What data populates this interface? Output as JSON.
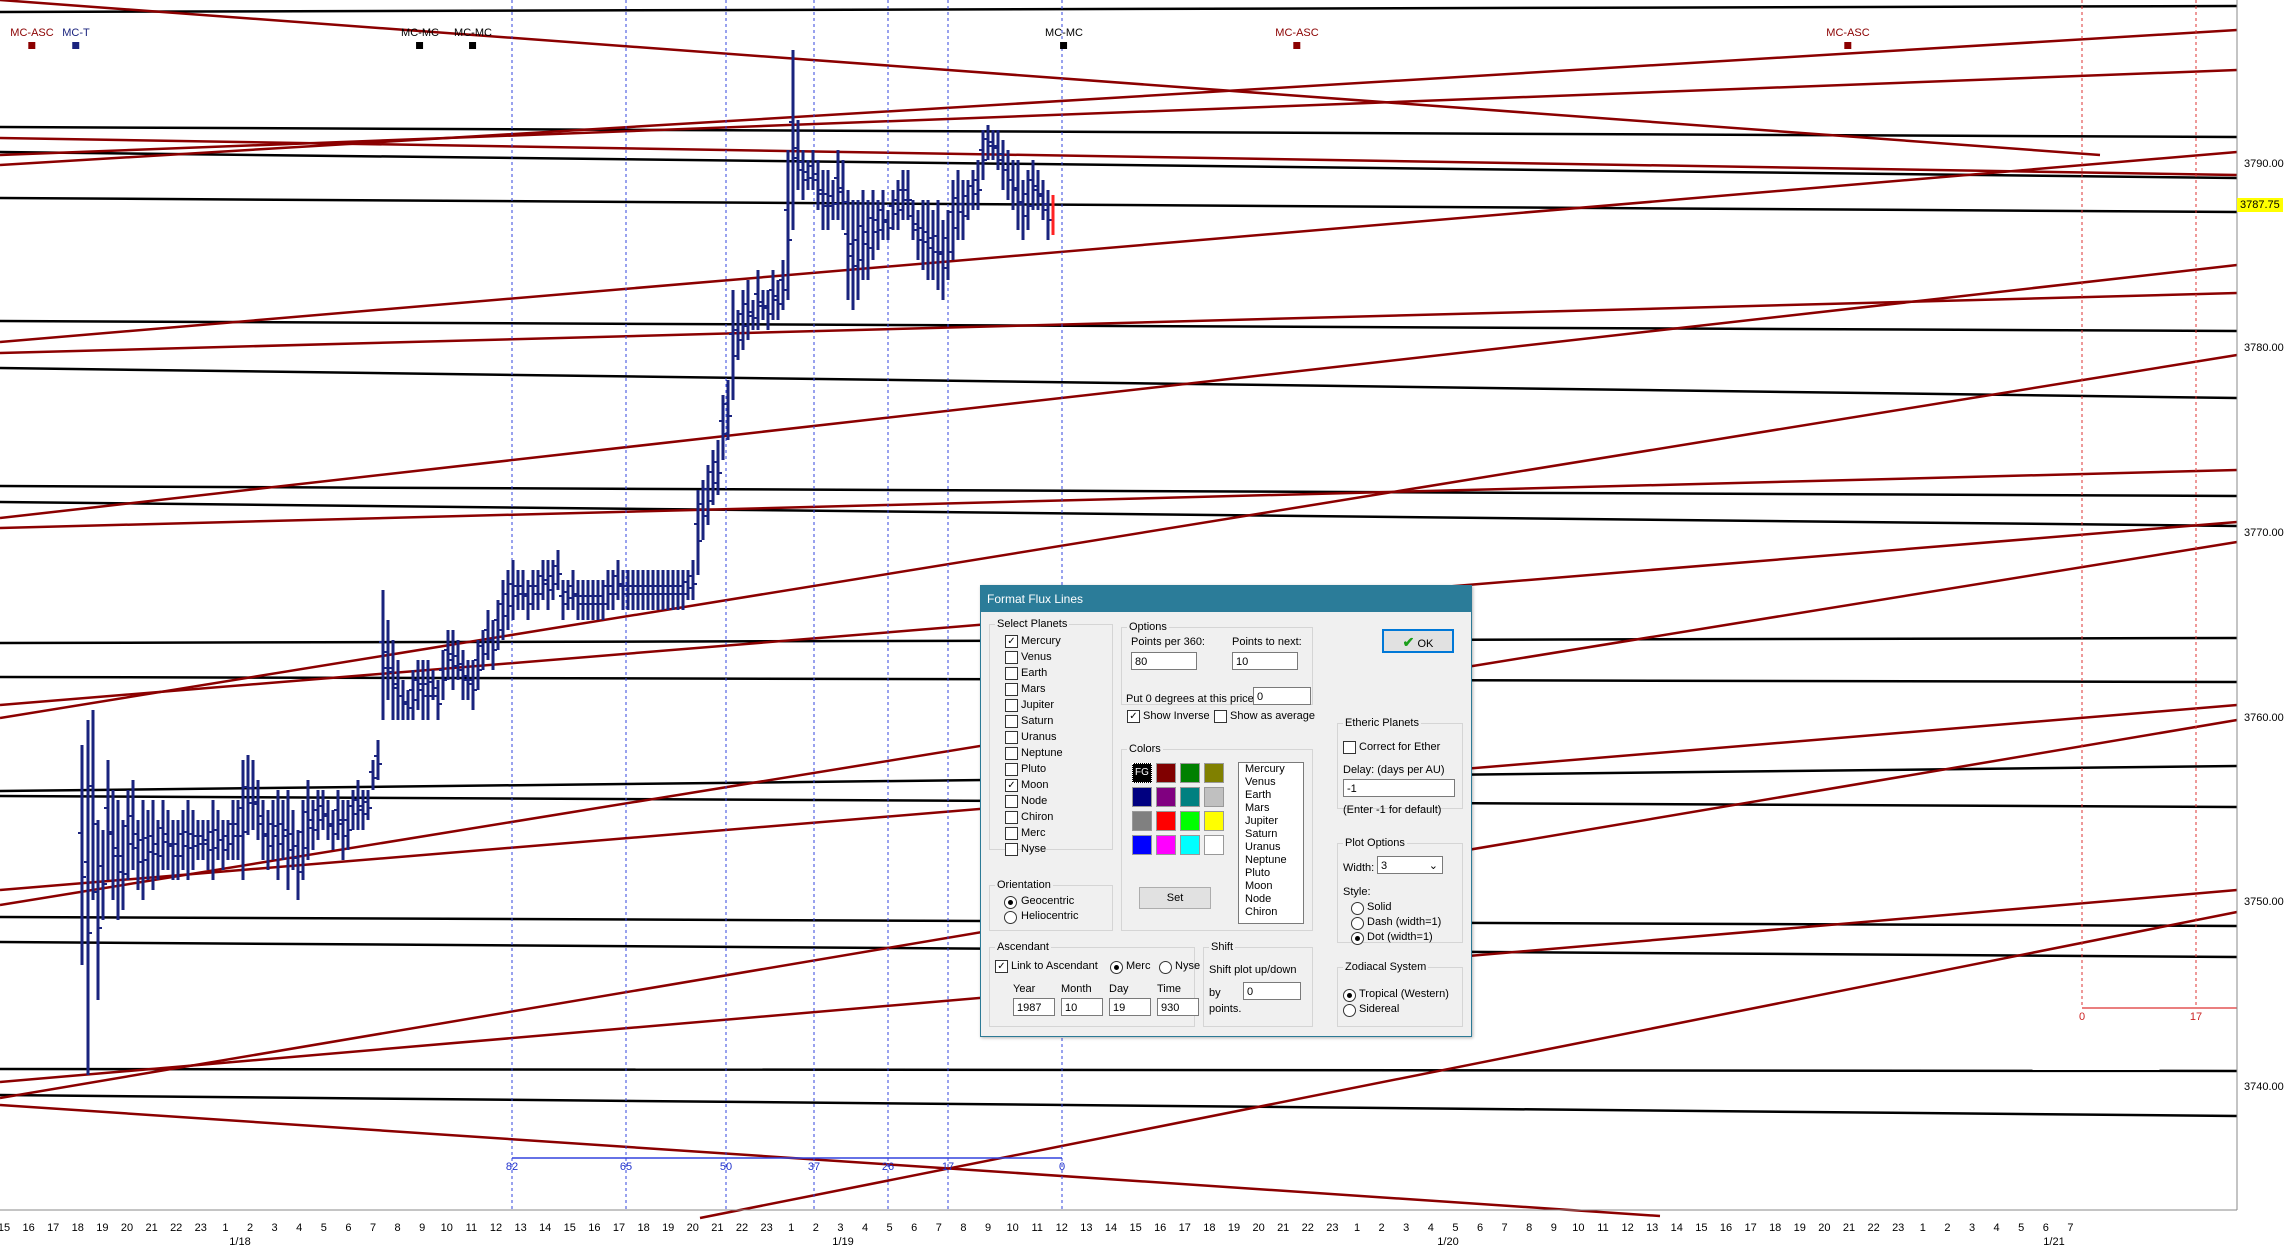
{
  "colors": {
    "bars": "#1a237e",
    "black_lines": "#000000",
    "red_lines": "#8b0000",
    "blue_dotted": "#3344dd",
    "red_dotted": "#dd3333",
    "last_bar": "#ff2222",
    "price_tag": "#ffff00"
  },
  "top_markers": [
    {
      "label": "MC-ASC",
      "color": "#8b0000"
    },
    {
      "label": "MC-T",
      "color": "#1a237e"
    },
    {
      "label": "MC-MC",
      "color": "#000000"
    },
    {
      "label": "MC-MC",
      "color": "#000000"
    },
    {
      "label": "MC-MC",
      "color": "#000000"
    },
    {
      "label": "MC-ASC",
      "color": "#8b0000"
    },
    {
      "label": "MC-ASC",
      "color": "#8b0000"
    }
  ],
  "y_axis": {
    "labels": [
      "3790.00",
      "3780.00",
      "3770.00",
      "3760.00",
      "3750.00",
      "3740.00"
    ],
    "current_price": "3787.75"
  },
  "x_axis": {
    "ticks": [
      "15",
      "16",
      "17",
      "18",
      "19",
      "20",
      "21",
      "22",
      "23",
      "1",
      "2",
      "3",
      "4",
      "5",
      "6",
      "7",
      "8",
      "9",
      "10",
      "11",
      "12",
      "13",
      "14",
      "15",
      "16",
      "17",
      "18",
      "19",
      "20",
      "21",
      "22",
      "23",
      "1",
      "2",
      "3",
      "4",
      "5",
      "6",
      "7",
      "8",
      "9",
      "10",
      "11",
      "12",
      "13",
      "14",
      "15",
      "16",
      "17",
      "18",
      "19",
      "20",
      "21",
      "22",
      "23",
      "1",
      "2",
      "3",
      "4",
      "5",
      "6",
      "7",
      "8",
      "9",
      "10",
      "11",
      "12",
      "13",
      "14",
      "15",
      "16",
      "17",
      "18",
      "19",
      "20",
      "21",
      "22",
      "23",
      "1",
      "2",
      "3",
      "4",
      "5",
      "6",
      "7"
    ],
    "dates": [
      "1/18",
      "1/19",
      "1/20",
      "1/21"
    ]
  },
  "cycle_labels": [
    "82",
    "65",
    "50",
    "37",
    "26",
    "17",
    "0"
  ],
  "right_cycle_labels": [
    "0",
    "17"
  ],
  "dialog": {
    "title": "Format Flux Lines",
    "select_planets": {
      "title": "Select Planets",
      "items": [
        {
          "name": "Mercury",
          "checked": true
        },
        {
          "name": "Venus",
          "checked": false
        },
        {
          "name": "Earth",
          "checked": false
        },
        {
          "name": "Mars",
          "checked": false
        },
        {
          "name": "Jupiter",
          "checked": false
        },
        {
          "name": "Saturn",
          "checked": false
        },
        {
          "name": "Uranus",
          "checked": false
        },
        {
          "name": "Neptune",
          "checked": false
        },
        {
          "name": "Pluto",
          "checked": false
        },
        {
          "name": "Moon",
          "checked": true
        },
        {
          "name": "Node",
          "checked": false
        },
        {
          "name": "Chiron",
          "checked": false
        },
        {
          "name": "Merc",
          "checked": false
        },
        {
          "name": "Nyse",
          "checked": false
        }
      ]
    },
    "orientation": {
      "title": "Orientation",
      "geocentric": "Geocentric",
      "heliocentric": "Heliocentric",
      "selected": "Geocentric"
    },
    "options": {
      "title": "Options",
      "points_per_360_label": "Points per 360:",
      "points_per_360": "80",
      "points_to_next_label": "Points to next:",
      "points_to_next": "10",
      "zero_degrees_label": "Put 0 degrees at this price:",
      "zero_degrees": "0",
      "show_inverse": "Show Inverse",
      "show_inverse_checked": true,
      "show_as_average": "Show as average",
      "show_as_average_checked": false
    },
    "colors_group": {
      "title": "Colors",
      "fg_label": "FG",
      "swatches": [
        "#000000",
        "#800000",
        "#008000",
        "#808000",
        "#000080",
        "#800080",
        "#008080",
        "#c0c0c0",
        "#808080",
        "#ff0000",
        "#00ff00",
        "#ffff00",
        "#0000ff",
        "#ff00ff",
        "#00ffff",
        "#ffffff"
      ],
      "list": [
        "Mercury",
        "Venus",
        "Earth",
        "Mars",
        "Jupiter",
        "Saturn",
        "Uranus",
        "Neptune",
        "Pluto",
        "Moon",
        "Node",
        "Chiron"
      ],
      "set_label": "Set"
    },
    "ok_label": "OK",
    "etheric": {
      "title": "Etheric Planets",
      "correct_label": "Correct for Ether",
      "correct_checked": false,
      "delay_label": "Delay: (days per AU)",
      "delay_value": "-1",
      "hint": "(Enter -1 for default)"
    },
    "plot_options": {
      "title": "Plot Options",
      "width_label": "Width:",
      "width_value": "3",
      "style_label": "Style:",
      "styles": [
        "Solid",
        "Dash (width=1)",
        "Dot (width=1)"
      ],
      "selected_style": "Dot (width=1)"
    },
    "ascendant": {
      "title": "Ascendant",
      "link_label": "Link to Ascendant",
      "link_checked": true,
      "merc": "Merc",
      "nyse": "Nyse",
      "selected": "Merc",
      "year_label": "Year",
      "year": "1987",
      "month_label": "Month",
      "month": "10",
      "day_label": "Day",
      "day": "19",
      "time_label": "Time",
      "time": "930"
    },
    "shift": {
      "title": "Shift",
      "desc": "Shift plot up/down",
      "by_label": "by",
      "by_value": "0",
      "points_label": "points."
    },
    "zodiacal": {
      "title": "Zodiacal System",
      "tropical": "Tropical (Western)",
      "sidereal": "Sidereal",
      "selected": "Tropical (Western)"
    }
  }
}
